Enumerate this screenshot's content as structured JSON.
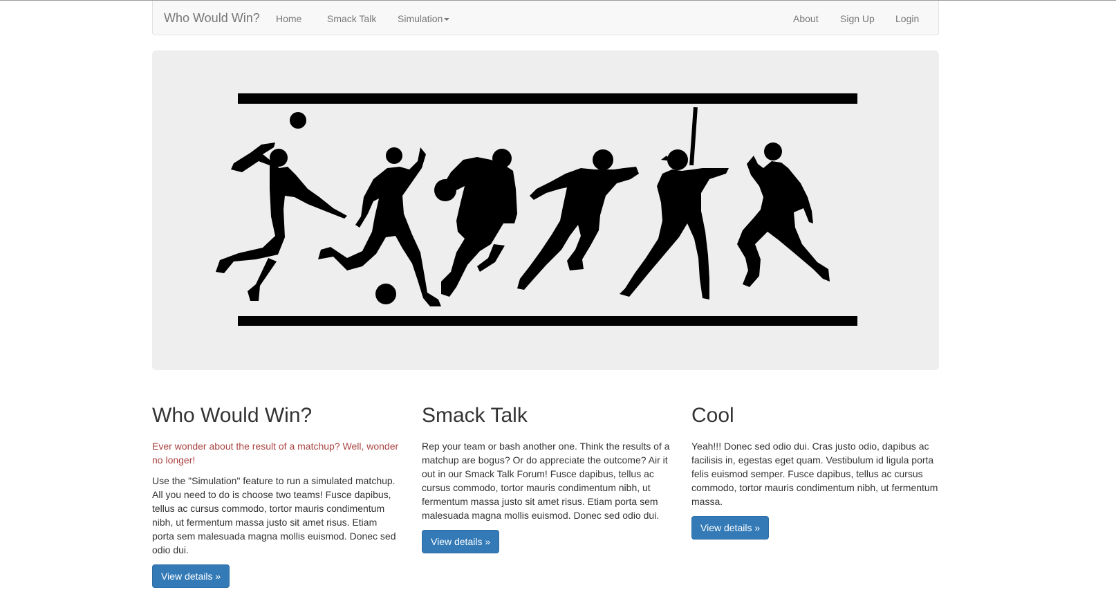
{
  "navbar": {
    "brand": "Who Would Win?",
    "left_items": [
      "Home",
      "Smack Talk",
      "Simulation"
    ],
    "right_items": [
      "About",
      "Sign Up",
      "Login"
    ]
  },
  "hero": {
    "image": "sports-silhouettes-banner",
    "fill_color": "#000000",
    "background": "#eeeeee"
  },
  "columns": [
    {
      "heading": "Who Would Win?",
      "tagline": "Ever wonder about the result of a matchup? Well, wonder no longer!",
      "body": "Use the \"Simulation\" feature to run a simulated matchup. All you need to do is choose two teams! Fusce dapibus, tellus ac cursus commodo, tortor mauris condimentum nibh, ut fermentum massa justo sit amet risus. Etiam porta sem malesuada magna mollis euismod. Donec sed odio dui.",
      "button": "View details »"
    },
    {
      "heading": "Smack Talk",
      "body": "Rep your team or bash another one. Think the results of a matchup are bogus? Or do appreciate the outcome? Air it out in our Smack Talk Forum! Fusce dapibus, tellus ac cursus commodo, tortor mauris condimentum nibh, ut fermentum massa justo sit amet risus. Etiam porta sem malesuada magna mollis euismod. Donec sed odio dui.",
      "button": "View details »"
    },
    {
      "heading": "Cool",
      "body": "Yeah!!! Donec sed odio dui. Cras justo odio, dapibus ac facilisis in, egestas eget quam. Vestibulum id ligula porta felis euismod semper. Fusce dapibus, tellus ac cursus commodo, tortor mauris condimentum nibh, ut fermentum massa.",
      "button": "View details »"
    }
  ],
  "colors": {
    "primary_button": "#337ab7",
    "tagline": "#a94442",
    "navbar_bg": "#f8f8f8"
  }
}
